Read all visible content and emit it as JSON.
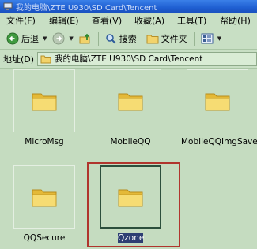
{
  "window": {
    "title": "我的电脑\\ZTE U930\\SD Card\\Tencent"
  },
  "menu": [
    "文件(F)",
    "编辑(E)",
    "查看(V)",
    "收藏(A)",
    "工具(T)",
    "帮助(H)"
  ],
  "toolbar": {
    "back_label": "后退",
    "search_label": "搜索",
    "folders_label": "文件夹"
  },
  "address": {
    "label": "地址(D)",
    "path": "我的电脑\\ZTE U930\\SD Card\\Tencent"
  },
  "folders": [
    {
      "name": "MicroMsg",
      "selected": false
    },
    {
      "name": "MobileQQ",
      "selected": false
    },
    {
      "name": "MobileQQImgSave",
      "selected": false
    },
    {
      "name": "QQSecure",
      "selected": false
    },
    {
      "name": "Qzone",
      "selected": true
    }
  ],
  "colors": {
    "background": "#c5dcc0",
    "selection_border": "#b0352d",
    "selected_label_bg": "#2d3f73"
  }
}
